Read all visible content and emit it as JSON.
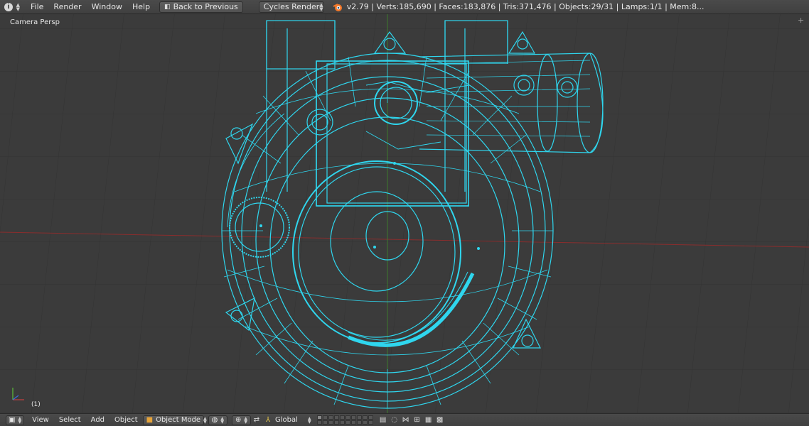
{
  "topbar": {
    "editor_type_icon": "info-icon",
    "menus": [
      "File",
      "Render",
      "Window",
      "Help"
    ],
    "back_button": "Back to Previous",
    "render_engine": "Cycles Render",
    "stats": "v2.79 | Verts:185,690 | Faces:183,876 | Tris:371,476 | Objects:29/31 | Lamps:1/1 | Mem:8..."
  },
  "viewport": {
    "view_label": "Camera Persp",
    "frame_label": "(1)",
    "wire_color": "#2fd6ee",
    "grid_color": "#333333",
    "x_axis_color": "#8a2d2d",
    "y_axis_color": "#3d7a2d"
  },
  "bottombar": {
    "menus": [
      "View",
      "Select",
      "Add",
      "Object"
    ],
    "mode": "Object Mode",
    "orientation": "Global"
  }
}
